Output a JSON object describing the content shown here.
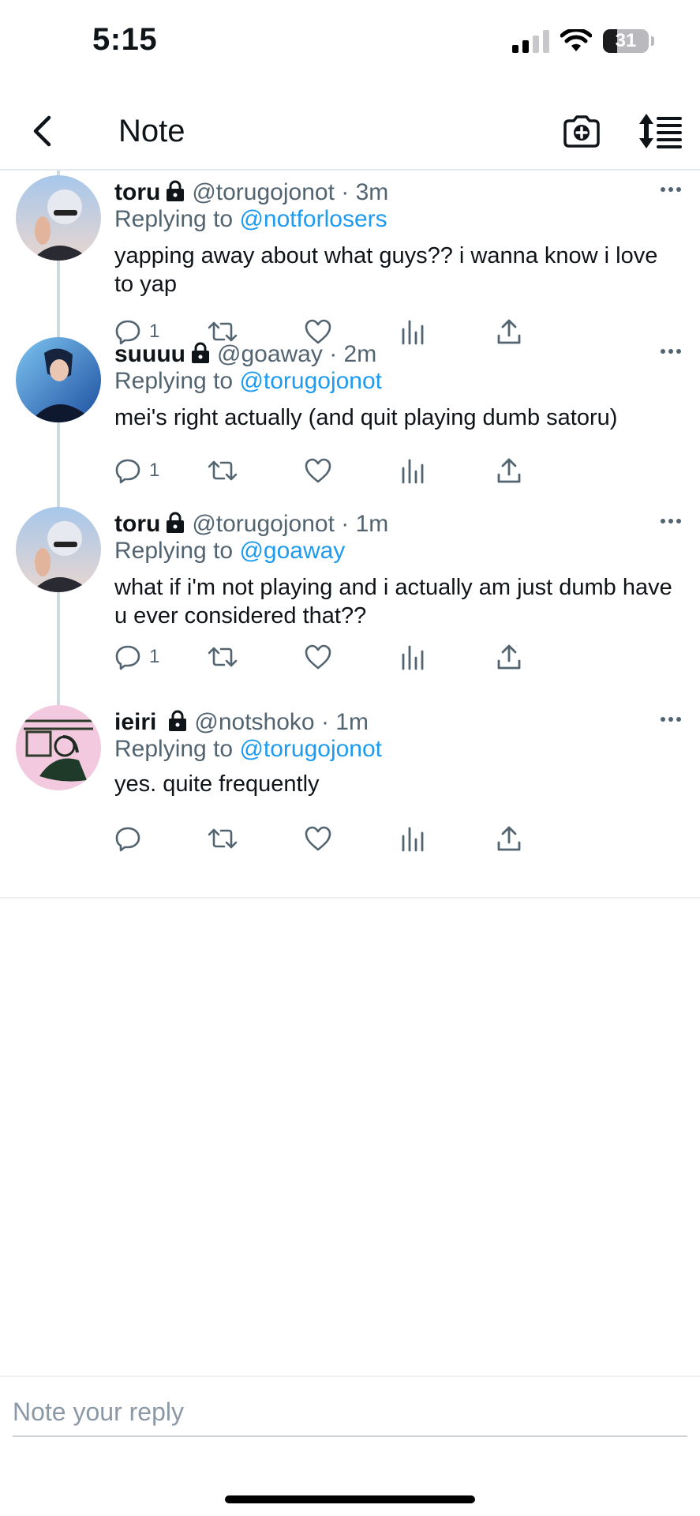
{
  "status_bar": {
    "time": "5:15",
    "battery_level": "31",
    "battery_fraction": 0.31,
    "signal_bars": 2,
    "wifi": true
  },
  "header": {
    "title": "Note",
    "back_icon": "chevron-left-icon",
    "camera_icon": "camera-icon",
    "sort_icon": "sort-icon"
  },
  "notes": [
    {
      "name": "toru",
      "locked": true,
      "handle": "@torugojonot",
      "time": "3m",
      "replying_prefix": "Replying to",
      "replying_to": "@notforlosers",
      "text": "yapping away about what guys?? i wanna know i love to yap",
      "reply_count": "1"
    },
    {
      "name": "suuuu",
      "locked": true,
      "handle": "@goaway",
      "time": "2m",
      "replying_prefix": "Replying to",
      "replying_to": "@torugojonot",
      "text": "mei's right actually (and quit playing dumb satoru)",
      "reply_count": "1"
    },
    {
      "name": "toru",
      "locked": true,
      "handle": "@torugojonot",
      "time": "1m",
      "replying_prefix": "Replying to",
      "replying_to": "@goaway",
      "text": "what if i'm not playing and i actually am just dumb have u ever considered that??",
      "reply_count": "1"
    },
    {
      "name": "ieiri",
      "locked": true,
      "handle": "@notshoko",
      "time": "1m",
      "replying_prefix": "Replying to",
      "replying_to": "@torugojonot",
      "text": "yes. quite frequently",
      "reply_count": ""
    }
  ],
  "action_icons": [
    "reply-icon",
    "renote-icon",
    "like-icon",
    "views-icon",
    "share-icon"
  ],
  "separator": "·",
  "composer": {
    "placeholder": "Note your reply"
  },
  "colors": {
    "link": "#1d9bf0",
    "muted": "#536471",
    "text": "#0f1419",
    "thread_line": "#cfd9de"
  }
}
